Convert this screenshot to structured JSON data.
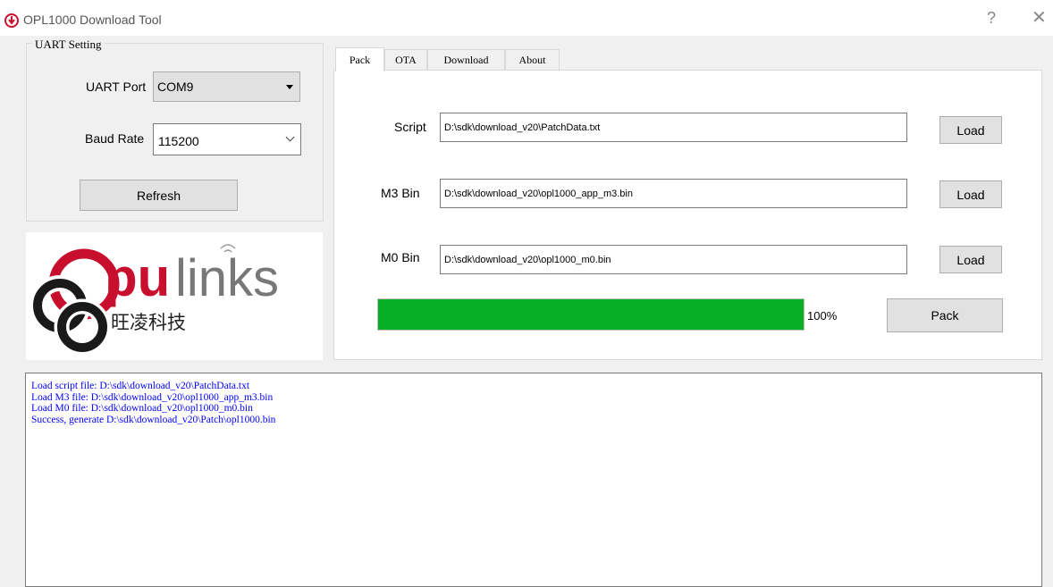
{
  "window": {
    "title": "OPL1000 Download Tool",
    "help_glyph": "?",
    "close_glyph": "✕"
  },
  "uart": {
    "group_title": "UART Setting",
    "port_label": "UART Port",
    "port_value": "COM9",
    "baud_label": "Baud Rate",
    "baud_value": "115200",
    "refresh_label": "Refresh"
  },
  "logo": {
    "brand_red": "pu",
    "brand_grey": "links",
    "chinese": "旺凌科技"
  },
  "tabs": [
    {
      "label": "Pack"
    },
    {
      "label": "OTA"
    },
    {
      "label": "Download"
    },
    {
      "label": "About"
    }
  ],
  "pack": {
    "script_label": "Script",
    "script_path": "D:\\sdk\\download_v20\\PatchData.txt",
    "m3_label": "M3 Bin",
    "m3_path": "D:\\sdk\\download_v20\\opl1000_app_m3.bin",
    "m0_label": "M0 Bin",
    "m0_path": "D:\\sdk\\download_v20\\opl1000_m0.bin",
    "load_label": "Load",
    "progress_text": "100%",
    "progress_value": 1.0,
    "pack_label": "Pack"
  },
  "log_lines": [
    "Load script file: D:\\sdk\\download_v20\\PatchData.txt",
    "Load M3 file: D:\\sdk\\download_v20\\opl1000_app_m3.bin",
    "Load M0 file: D:\\sdk\\download_v20\\opl1000_m0.bin",
    "Success, generate D:\\sdk\\download_v20\\Patch\\opl1000.bin"
  ],
  "colors": {
    "brand_red": "#c8102e",
    "progress_green": "#06b025",
    "log_blue": "#0000ff"
  }
}
